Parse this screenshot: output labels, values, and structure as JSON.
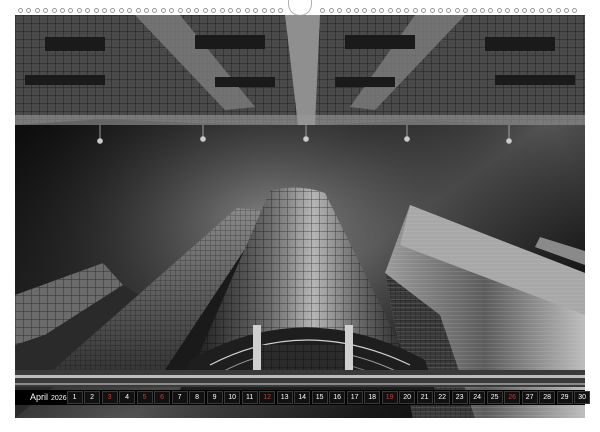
{
  "calendar": {
    "month": "April",
    "year": "2026",
    "days": [
      {
        "n": "1",
        "red": false
      },
      {
        "n": "2",
        "red": false
      },
      {
        "n": "3",
        "red": true
      },
      {
        "n": "4",
        "red": false
      },
      {
        "n": "5",
        "red": true
      },
      {
        "n": "6",
        "red": true
      },
      {
        "n": "7",
        "red": false
      },
      {
        "n": "8",
        "red": false
      },
      {
        "n": "9",
        "red": false
      },
      {
        "n": "10",
        "red": false
      },
      {
        "n": "11",
        "red": false
      },
      {
        "n": "12",
        "red": true
      },
      {
        "n": "13",
        "red": false
      },
      {
        "n": "14",
        "red": false
      },
      {
        "n": "15",
        "red": false
      },
      {
        "n": "16",
        "red": false
      },
      {
        "n": "17",
        "red": false
      },
      {
        "n": "18",
        "red": false
      },
      {
        "n": "19",
        "red": true
      },
      {
        "n": "20",
        "red": false
      },
      {
        "n": "21",
        "red": false
      },
      {
        "n": "22",
        "red": false
      },
      {
        "n": "23",
        "red": false
      },
      {
        "n": "24",
        "red": false
      },
      {
        "n": "25",
        "red": false
      },
      {
        "n": "26",
        "red": true
      },
      {
        "n": "27",
        "red": false
      },
      {
        "n": "28",
        "red": false
      },
      {
        "n": "29",
        "red": false
      },
      {
        "n": "30",
        "red": false
      }
    ]
  },
  "colors": {
    "strip_bg": "#000000",
    "weekday_text": "#ffffff",
    "sunday_holiday_text": "#e0302a"
  }
}
